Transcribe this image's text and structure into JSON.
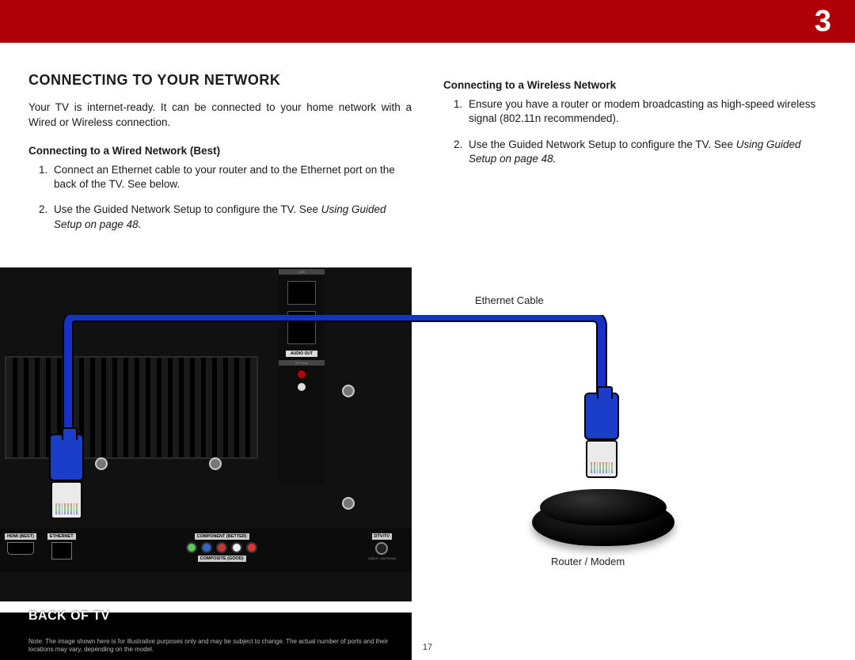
{
  "page_number_large": "3",
  "page_footer": "17",
  "section_title": "CONNECTING TO YOUR NETWORK",
  "intro": "Your TV is internet-ready. It can be connected to your home network with a Wired or Wireless connection.",
  "wired": {
    "heading": "Connecting to a Wired Network (Best)",
    "steps": [
      "Connect an Ethernet cable to your router and to the Ethernet port on the back of the TV. See below.",
      "Use the Guided Network Setup to configure the TV. See "
    ],
    "ref": "Using Guided Setup on page 48."
  },
  "wireless": {
    "heading": "Connecting to a Wireless Network",
    "steps": [
      "Ensure you have a router or modem broadcasting as high-speed wireless signal (802.11n recommended).",
      "Use the Guided Network Setup to configure the TV. See "
    ],
    "ref": "Using Guided Setup on page 48."
  },
  "diagram": {
    "ethernet_cable_label": "Ethernet Cable",
    "router_label": "Router / Modem",
    "back_of_tv": "BACK OF TV",
    "note": "Note:  The image shown here is for illustrative purposes only and may be subject to change. The actual number of ports and their locations may vary, depending on the model.",
    "port_labels": {
      "usb": "USB",
      "audio_out": "AUDIO OUT",
      "optical": "OPTICAL",
      "hdmi": "HDMI (BEST)",
      "ethernet": "ETHERNET",
      "component": "COMPONENT (BETTER)",
      "composite": "COMPOSITE (GOOD)",
      "dtv": "DTV/TV",
      "coax": "CABLE / ANTENNA"
    }
  }
}
